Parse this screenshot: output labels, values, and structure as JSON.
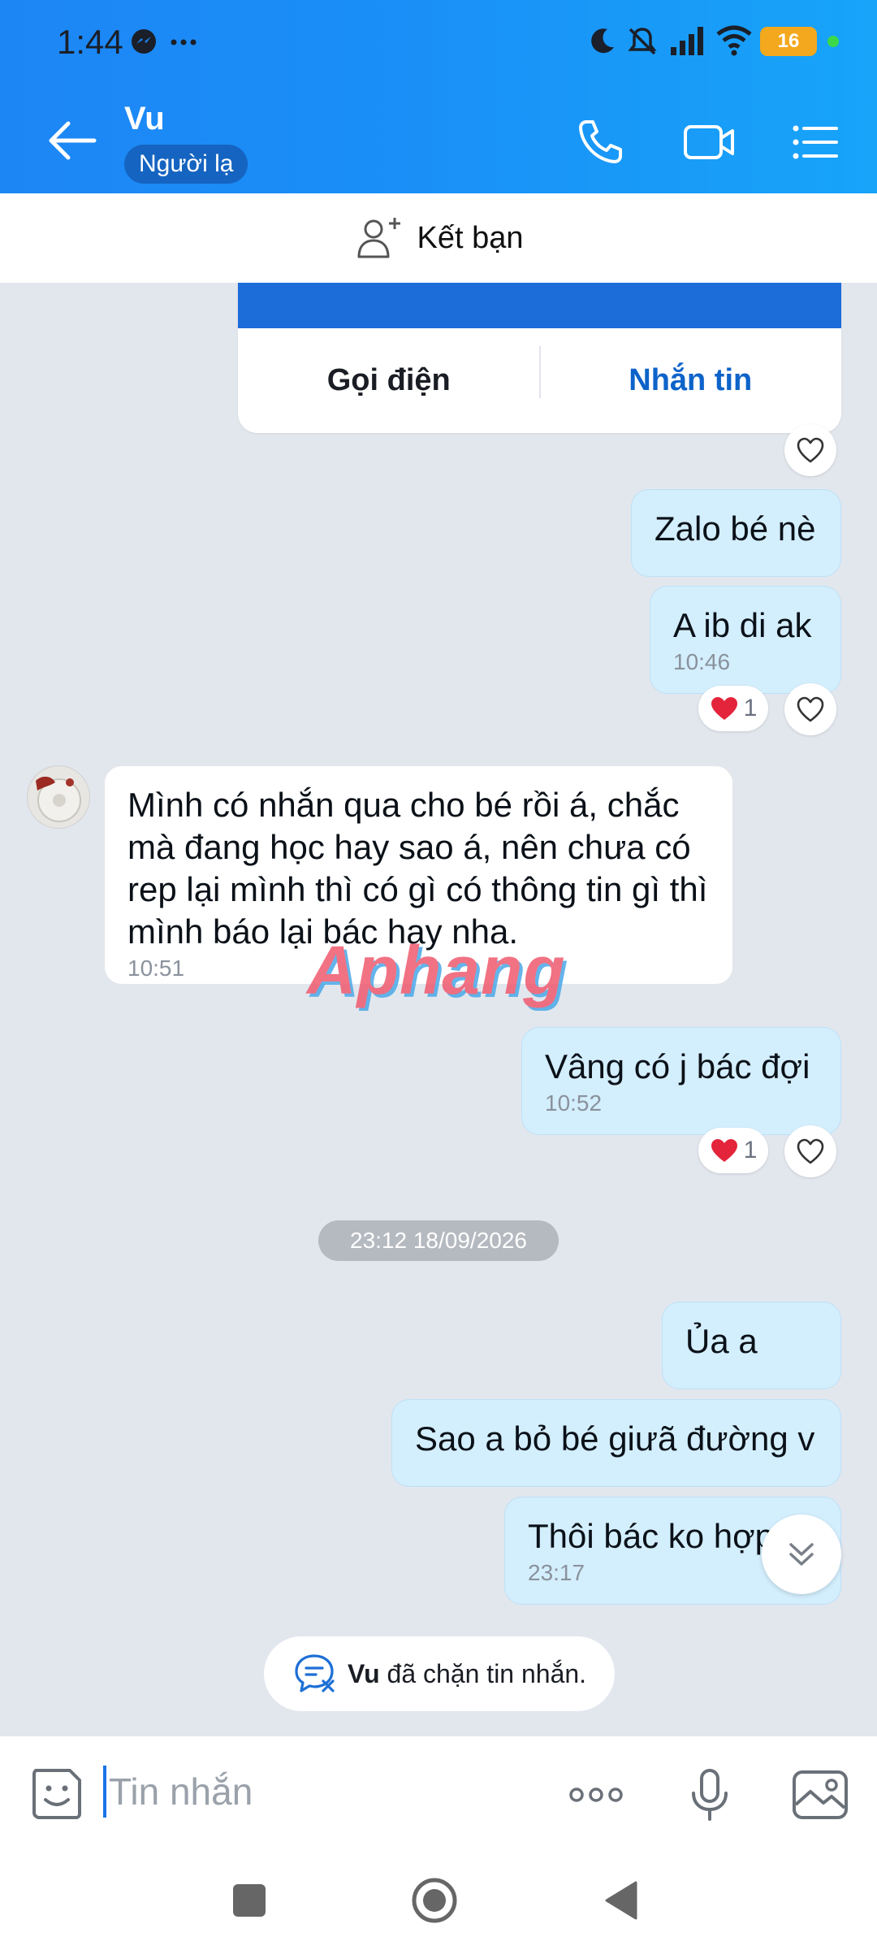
{
  "status_bar": {
    "time": "1:44",
    "battery": "16"
  },
  "header": {
    "contact_name": "Vu",
    "stranger_badge": "Người lạ"
  },
  "add_friend": {
    "label": "Kết bạn"
  },
  "card": {
    "call_label": "Gọi điện",
    "message_label": "Nhắn tin"
  },
  "messages": [
    {
      "direction": "out",
      "text": "Zalo bé nè",
      "time": ""
    },
    {
      "direction": "out",
      "text": "A ib di ak",
      "time": "10:46",
      "reaction": {
        "emoji": "heart",
        "count": "1"
      }
    },
    {
      "direction": "in",
      "text": "Mình có nhắn qua cho bé rồi á, chắc mà đang học hay sao á, nên chưa có rep lại mình thì có gì có thông tin gì thì mình báo lại bác hay nha.",
      "time": "10:51"
    },
    {
      "direction": "out",
      "text": "Vâng có j bác đợi",
      "time": "10:52",
      "reaction": {
        "emoji": "heart",
        "count": "1"
      }
    },
    {
      "direction": "out",
      "text": "Ủa a",
      "time": ""
    },
    {
      "direction": "out",
      "text": "Sao a bỏ bé giưã đường v",
      "time": ""
    },
    {
      "direction": "out",
      "text": "Thôi bác ko hợp",
      "time": "23:17"
    }
  ],
  "date_separator": "23:12 18/09/2026",
  "watermark": "Aphang",
  "blocked_notice": {
    "name": "Vu",
    "text": " đã chặn tin nhắn."
  },
  "input": {
    "placeholder": "Tin nhắn"
  },
  "icons": {
    "back": "arrow-left-icon",
    "call": "phone-icon",
    "video": "video-camera-icon",
    "menu": "list-menu-icon",
    "add_friend": "add-person-icon",
    "heart": "heart-outline-icon",
    "emoji": "emoji-sticker-icon",
    "more": "more-dots-icon",
    "mic": "microphone-icon",
    "image": "image-icon",
    "scroll_down": "chevron-double-down-icon"
  },
  "colors": {
    "header_start": "#1d86f5",
    "header_end": "#17a4f9",
    "outgoing_bubble": "#d3eefd",
    "accent": "#0d63c9",
    "chat_bg": "#e2e7ee"
  }
}
